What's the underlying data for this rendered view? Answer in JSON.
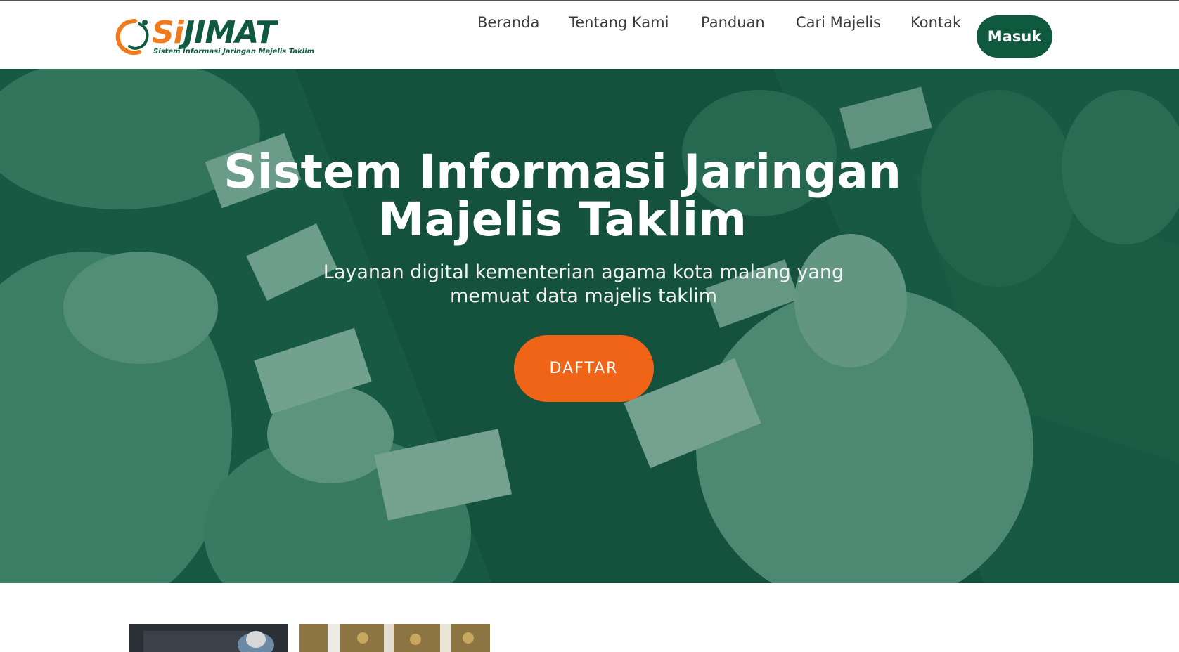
{
  "header": {
    "logo": {
      "word_si": "Si",
      "word_jimat": "JIMAT",
      "tagline": "Sistem Informasi Jaringan Majelis Taklim"
    },
    "nav": [
      {
        "label": "Beranda"
      },
      {
        "label": "Tentang Kami"
      },
      {
        "label": "Panduan"
      },
      {
        "label": "Cari Majelis"
      },
      {
        "label": "Kontak"
      }
    ],
    "login_label": "Masuk"
  },
  "hero": {
    "title_line1": "Sistem Informasi Jaringan",
    "title_line2": "Majelis Taklim",
    "subtitle_line1": "Layanan digital kementerian agama kota malang yang",
    "subtitle_line2": "memuat data majelis taklim",
    "cta_label": "DAFTAR"
  },
  "colors": {
    "brand_green": "#0f5a3e",
    "brand_orange": "#f06418",
    "nav_text": "#3b3b3b"
  }
}
